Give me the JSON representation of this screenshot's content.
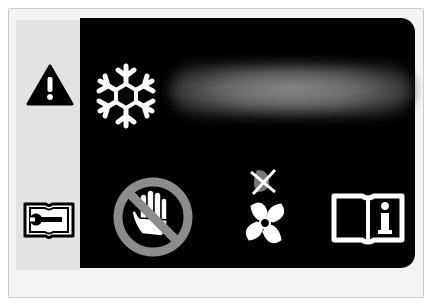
{
  "display": {
    "status_text": "",
    "colors": {
      "screen_bg": "#000000",
      "sidebar_bg": "#e3e3e3",
      "icon_light": "#ffffff",
      "prohibit_ring": "#8c8c8c"
    }
  },
  "sidebar": {
    "items": [
      {
        "icon": "warning-icon"
      },
      {
        "icon": "service-manual-icon"
      }
    ]
  },
  "screen": {
    "icons": [
      {
        "icon": "snowflake-icon"
      },
      {
        "icon": "do-not-touch-icon"
      },
      {
        "icon": "fan-off-icon"
      },
      {
        "icon": "info-manual-icon"
      }
    ]
  }
}
